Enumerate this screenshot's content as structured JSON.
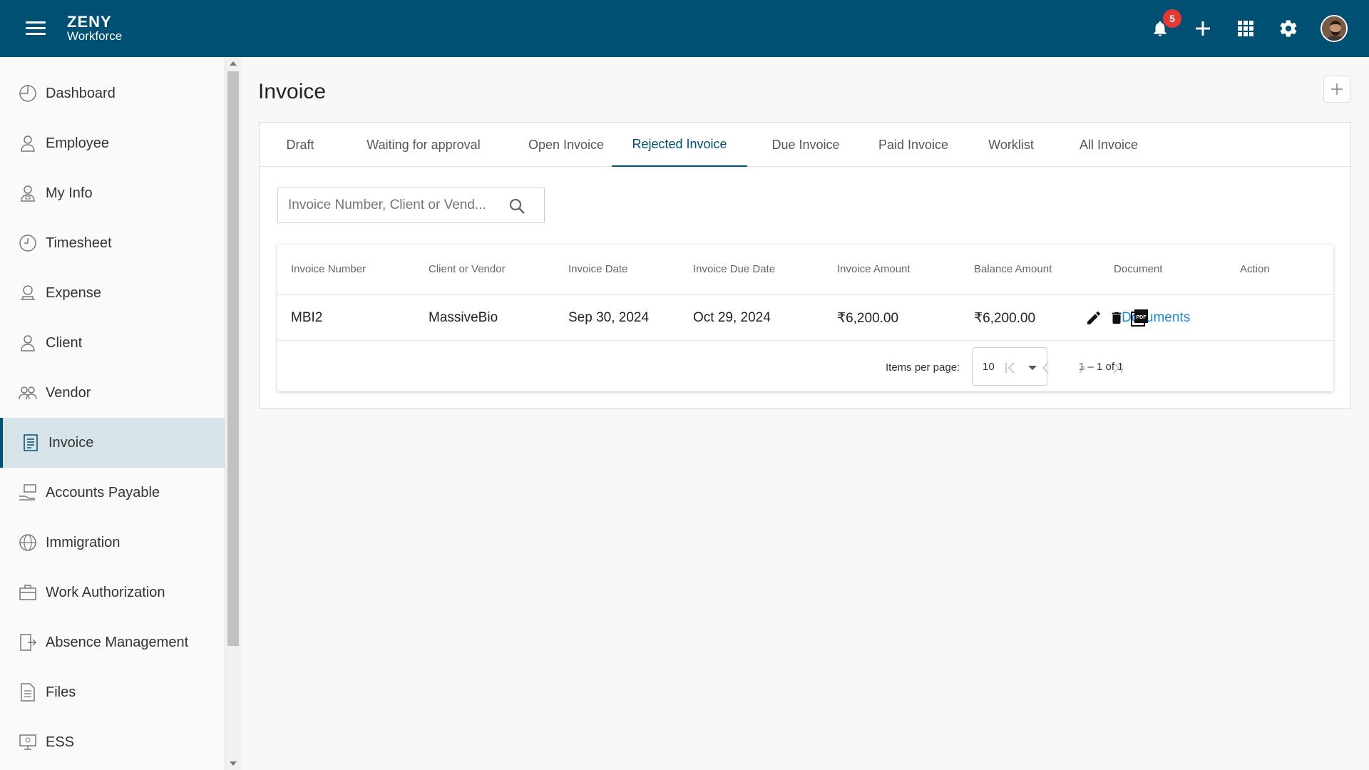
{
  "header": {
    "logo_line1": "ZENY",
    "logo_line2": "Workforce",
    "notification_count": "5",
    "icons": [
      "notifications-icon",
      "add-icon",
      "apps-icon",
      "settings-icon",
      "avatar"
    ]
  },
  "sidebar": {
    "items": [
      {
        "label": "Dashboard",
        "icon": "dashboard-icon"
      },
      {
        "label": "Employee",
        "icon": "employee-icon"
      },
      {
        "label": "My Info",
        "icon": "my-info-icon"
      },
      {
        "label": "Timesheet",
        "icon": "clock-icon"
      },
      {
        "label": "Expense",
        "icon": "expense-icon"
      },
      {
        "label": "Client",
        "icon": "client-icon"
      },
      {
        "label": "Vendor",
        "icon": "vendor-icon"
      },
      {
        "label": "Invoice",
        "icon": "invoice-icon",
        "active": true
      },
      {
        "label": "Accounts Payable",
        "icon": "accounts-payable-icon"
      },
      {
        "label": "Immigration",
        "icon": "globe-icon"
      },
      {
        "label": "Work Authorization",
        "icon": "briefcase-icon"
      },
      {
        "label": "Absence Management",
        "icon": "absence-icon"
      },
      {
        "label": "Files",
        "icon": "file-icon"
      },
      {
        "label": "ESS",
        "icon": "ess-icon"
      }
    ]
  },
  "page": {
    "title": "Invoice"
  },
  "tabs": [
    {
      "label": "Draft"
    },
    {
      "label": "Waiting for approval"
    },
    {
      "label": "Open Invoice"
    },
    {
      "label": "Rejected Invoice",
      "active": true
    },
    {
      "label": "Due Invoice"
    },
    {
      "label": "Paid Invoice"
    },
    {
      "label": "Worklist"
    },
    {
      "label": "All Invoice"
    }
  ],
  "search": {
    "placeholder": "Invoice Number, Client or Vend..."
  },
  "table": {
    "columns": [
      "Invoice Number",
      "Client or Vendor",
      "Invoice Date",
      "Invoice Due Date",
      "Invoice Amount",
      "Balance Amount",
      "Document",
      "Action"
    ],
    "rows": [
      {
        "invoice_number": "MBI2",
        "client_or_vendor": "MassiveBio",
        "invoice_date": "Sep 30, 2024",
        "invoice_due_date": "Oct 29, 2024",
        "invoice_amount": "₹6,200.00",
        "balance_amount": "₹6,200.00",
        "document": "+Documents"
      }
    ]
  },
  "pagination": {
    "items_per_page_label": "Items per page:",
    "items_per_page_value": "10",
    "range": "1 – 1 of 1"
  },
  "colors": {
    "header_bg": "#005073",
    "accent": "#005073",
    "link": "#1e88e5",
    "badge": "#e53935"
  }
}
